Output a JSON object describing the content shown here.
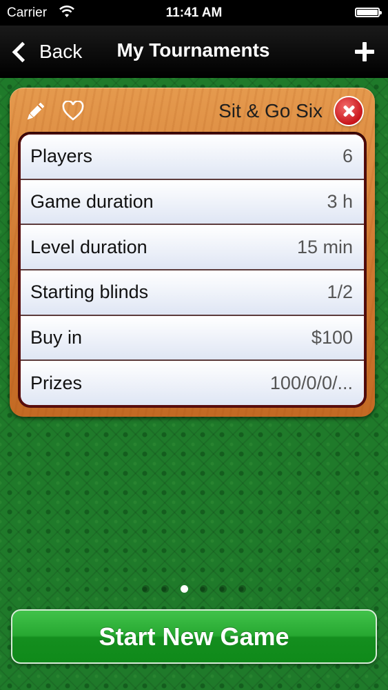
{
  "status_bar": {
    "carrier": "Carrier",
    "time": "11:41 AM"
  },
  "nav": {
    "back_label": "Back",
    "title": "My Tournaments"
  },
  "card": {
    "title": "Sit & Go Six",
    "rows": [
      {
        "label": "Players",
        "value": "6"
      },
      {
        "label": "Game duration",
        "value": "3 h"
      },
      {
        "label": "Level duration",
        "value": "15 min"
      },
      {
        "label": "Starting blinds",
        "value": "1/2"
      },
      {
        "label": "Buy in",
        "value": "$100"
      },
      {
        "label": "Prizes",
        "value": "100/0/0/..."
      }
    ]
  },
  "pager": {
    "total": 6,
    "current": 3
  },
  "start_button_label": "Start New Game",
  "colors": {
    "felt": "#1f7a2a",
    "wood": "#d07a32",
    "start_green": "#27a831",
    "delete_red": "#c8151b"
  }
}
